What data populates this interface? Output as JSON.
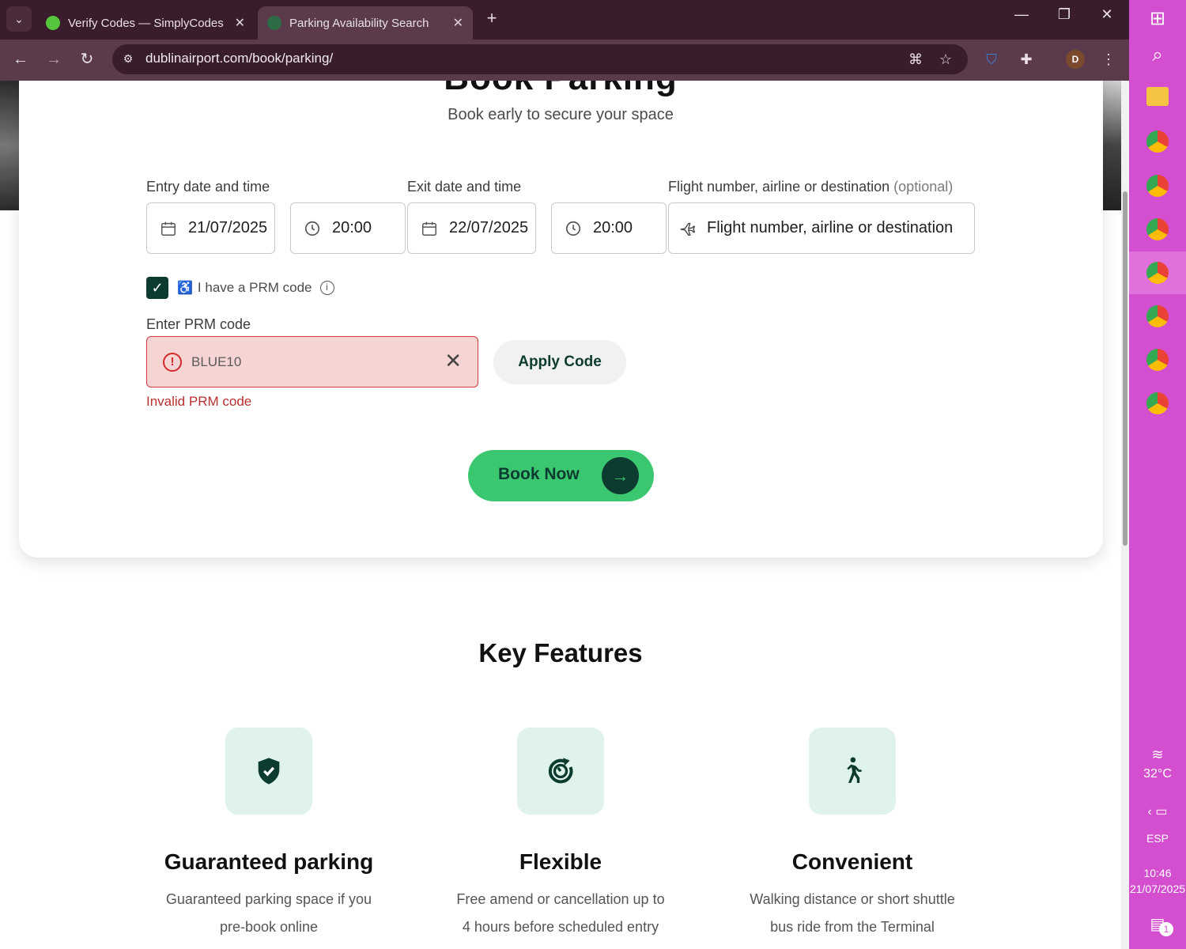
{
  "browser": {
    "tabs": [
      {
        "title": "Verify Codes — SimplyCodes",
        "active": false
      },
      {
        "title": "Parking Availability Search",
        "active": true
      }
    ],
    "url": "dublinairport.com/book/parking/",
    "profile_initial": "D"
  },
  "page": {
    "title": "Book Parking",
    "subtitle": "Book early to secure your space",
    "entry_label": "Entry date and time",
    "exit_label": "Exit date and time",
    "flight_label": "Flight number, airline or destination",
    "flight_label_optional": "(optional)",
    "entry_date": "21/07/2025",
    "entry_time": "20:00",
    "exit_date": "22/07/2025",
    "exit_time": "20:00",
    "flight_placeholder": "Flight number, airline or destination",
    "prm_checkbox_label": "I have a PRM code",
    "prm_input_label": "Enter PRM code",
    "prm_code_value": "BLUE10",
    "apply_button": "Apply Code",
    "prm_error": "Invalid PRM code",
    "book_button": "Book Now",
    "features_title": "Key Features",
    "features": [
      {
        "title": "Guaranteed parking",
        "line1": "Guaranteed parking space if you",
        "line2": "pre-book online",
        "icon": "shield-check-icon"
      },
      {
        "title": "Flexible",
        "line1": "Free amend or cancellation up to",
        "line2": "4 hours before scheduled entry",
        "icon": "clock-refresh-icon"
      },
      {
        "title": "Convenient",
        "line1": "Walking distance or short shuttle",
        "line2": "bus ride from the Terminal",
        "icon": "walking-person-icon"
      }
    ]
  },
  "taskbar": {
    "temperature": "32°C",
    "language": "ESP",
    "time": "10:46",
    "date": "21/07/2025",
    "notification_count": "1"
  },
  "colors": {
    "brand_dark": "#0c3b2f",
    "brand_green": "#3bc770",
    "error_red": "#d02a2a",
    "taskbar": "#d44fcf"
  }
}
